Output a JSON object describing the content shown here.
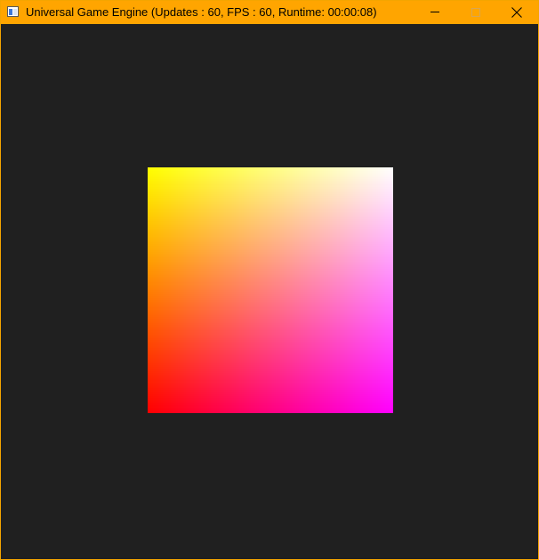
{
  "window": {
    "title": "Universal Game Engine (Updates : 60,  FPS : 60, Runtime: 00:00:08)",
    "app_icon": "window-app-icon",
    "controls": {
      "minimize_icon": "minimize-icon",
      "maximize_icon": "maximize-icon",
      "close_icon": "close-icon"
    },
    "colors": {
      "titlebar": "#ffa500",
      "border": "#f5a500",
      "viewport_background": "#202020"
    }
  },
  "scene": {
    "quad_vertex_colors": {
      "top_left": "#ffff00",
      "top_right": "#ffffff",
      "bottom_left": "#ff0000",
      "bottom_right": "#ff00ff"
    }
  }
}
